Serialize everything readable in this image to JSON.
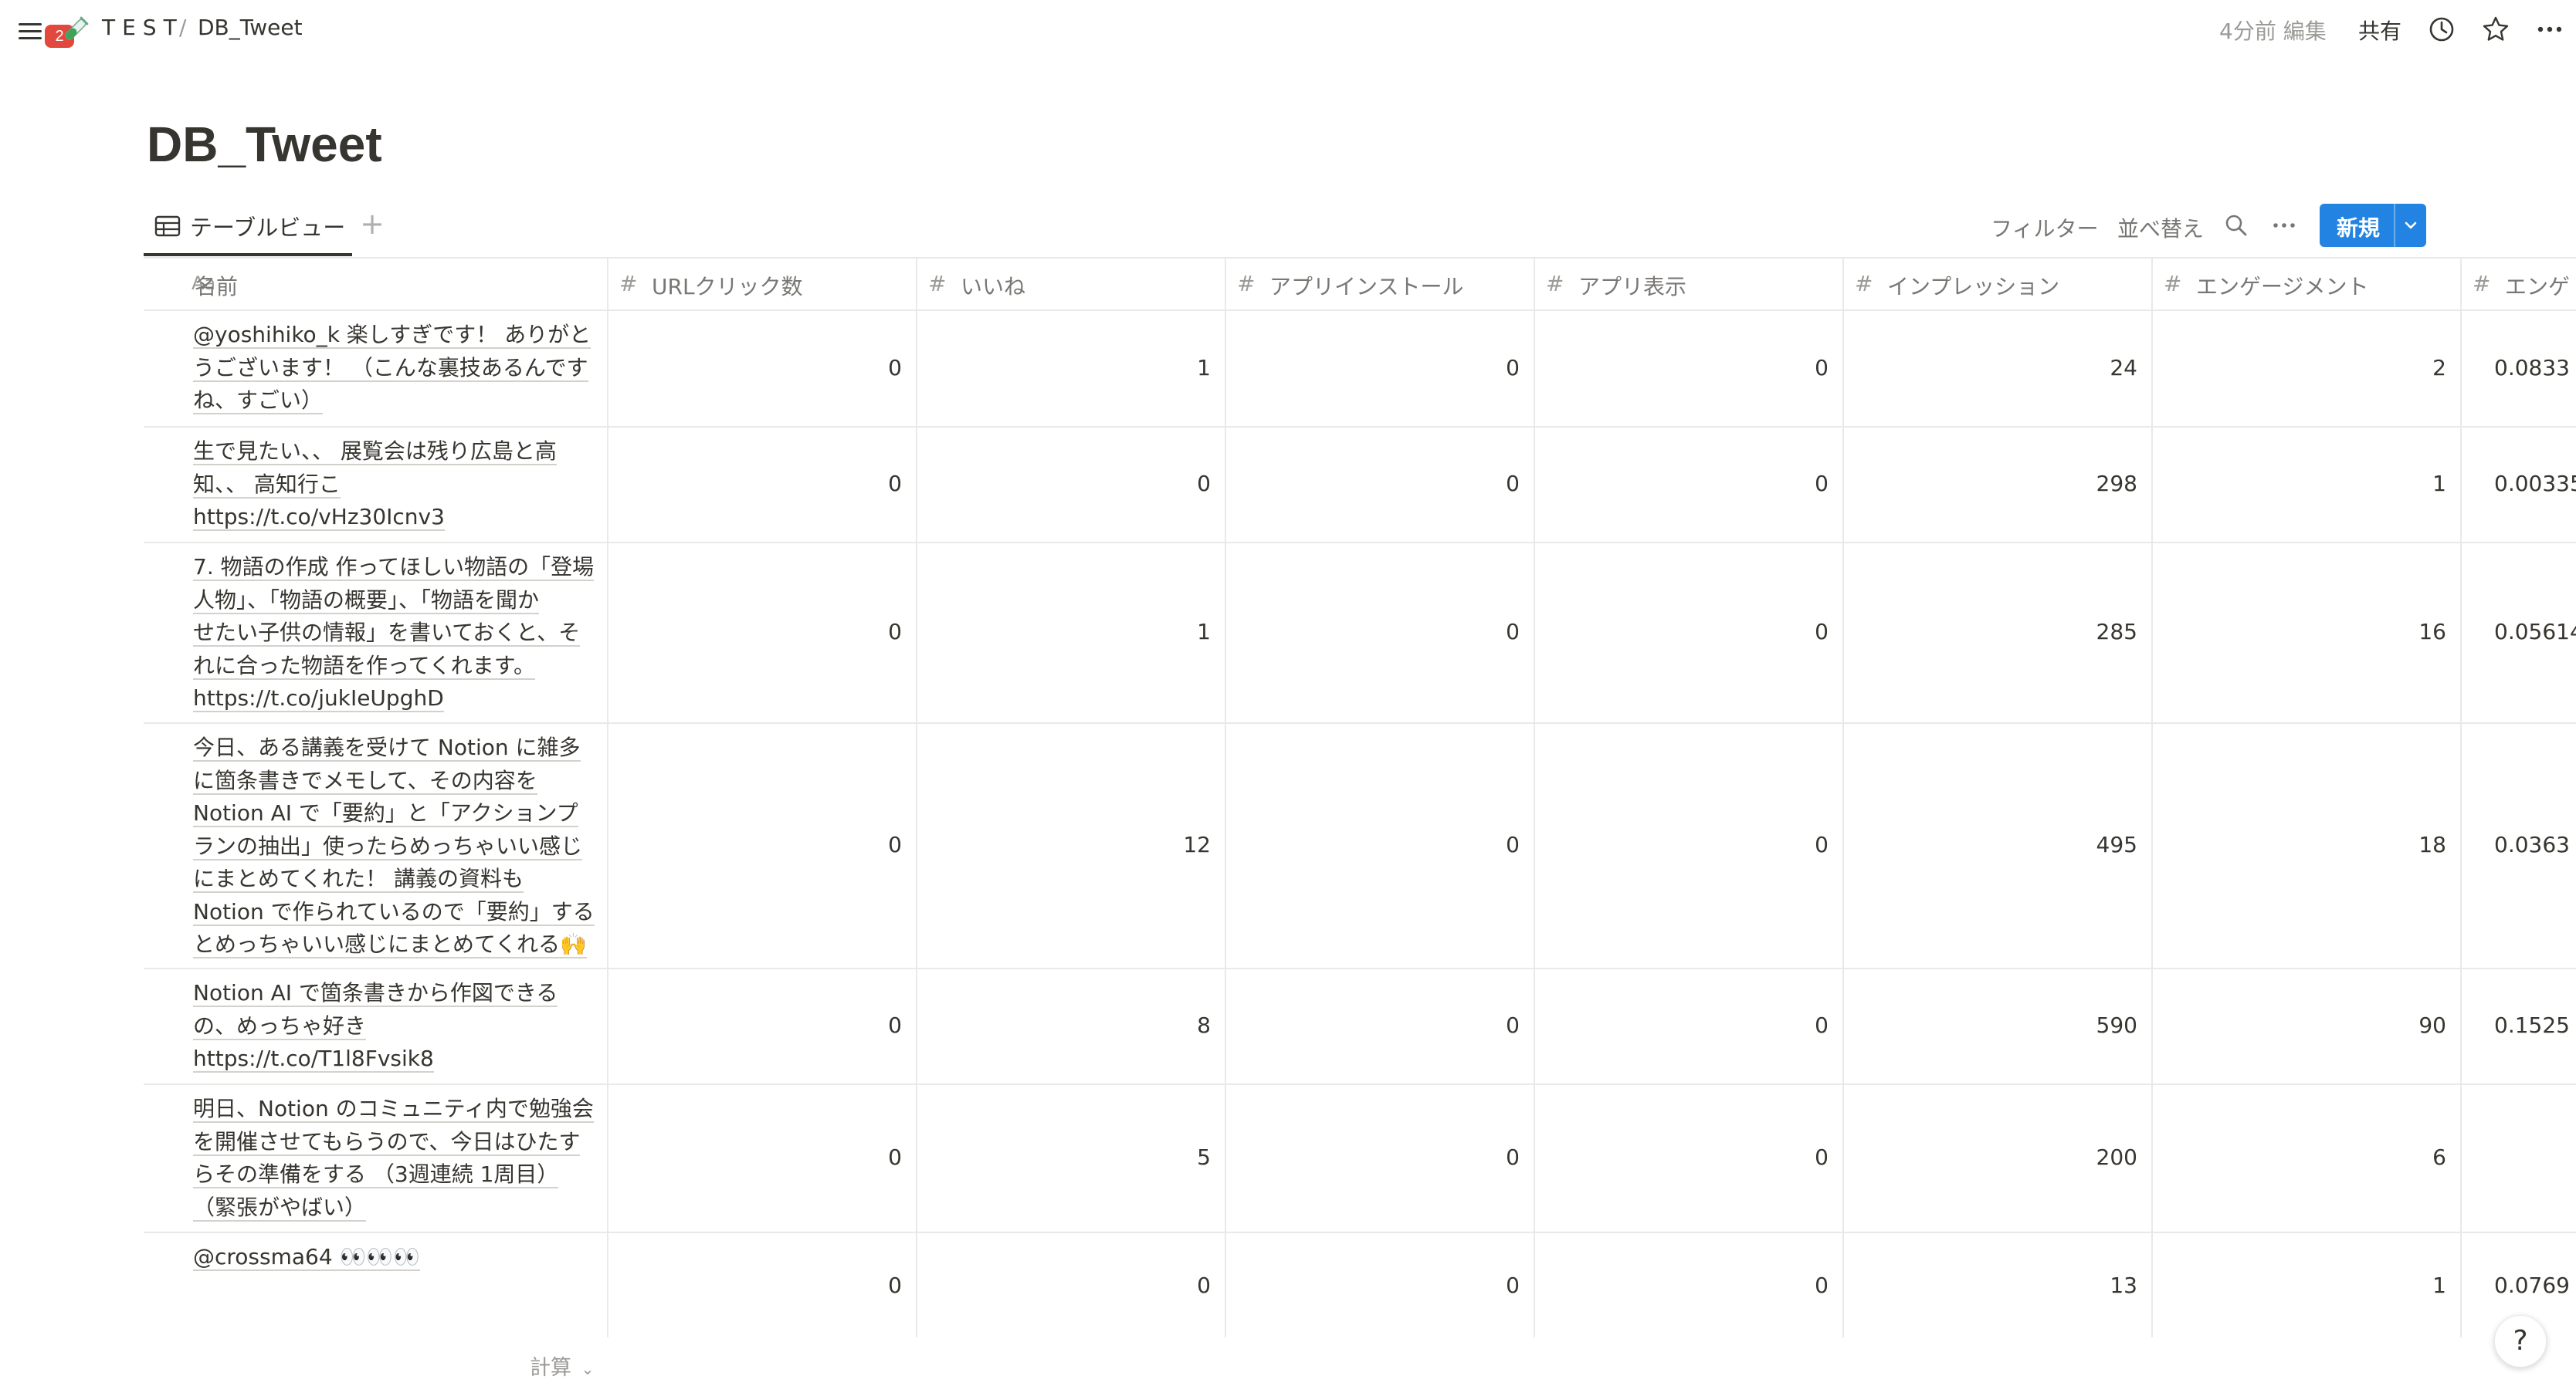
{
  "topbar": {
    "notification_count": "2",
    "workspace": "TEST",
    "separator": "/",
    "page": "DB_Tweet",
    "edited": "4分前 編集",
    "share": "共有",
    "page_icon": "test-tube-icon"
  },
  "title": "DB_Tweet",
  "view": {
    "tab_label": "テーブルビュー",
    "add": "+",
    "filter": "フィルター",
    "sort": "並べ替え",
    "new": "新規"
  },
  "columns": [
    {
      "icon": "Aa",
      "label": "名前"
    },
    {
      "icon": "#",
      "label": "URLクリック数"
    },
    {
      "icon": "#",
      "label": "いいね"
    },
    {
      "icon": "#",
      "label": "アプリインストール"
    },
    {
      "icon": "#",
      "label": "アプリ表示"
    },
    {
      "icon": "#",
      "label": "インプレッション"
    },
    {
      "icon": "#",
      "label": "エンゲージメント"
    },
    {
      "icon": "#",
      "label": "エンゲ"
    }
  ],
  "rows": [
    {
      "lines": [
        "@yoshihiko_k 楽しすぎです！ ありがと",
        "うございます！ （こんな裏技あるんです",
        "ね、すごい）"
      ],
      "url_clicks": "0",
      "likes": "1",
      "app_installs": "0",
      "app_views": "0",
      "impressions": "24",
      "engagements": "2",
      "rate": "0.0833"
    },
    {
      "lines": [
        "生で見たい、、 展覧会は残り広島と高",
        "知、、 高知行こ",
        "https://t.co/vHz30Icnv3"
      ],
      "url_clicks": "0",
      "likes": "0",
      "app_installs": "0",
      "app_views": "0",
      "impressions": "298",
      "engagements": "1",
      "rate": "0.00335"
    },
    {
      "lines": [
        "7. 物語の作成 作ってほしい物語の「登場",
        "人物」、「物語の概要」、「物語を聞か",
        "せたい子供の情報」を書いておくと、そ",
        "れに合った物語を作ってくれます。",
        "https://t.co/jukIeUpghD"
      ],
      "url_clicks": "0",
      "likes": "1",
      "app_installs": "0",
      "app_views": "0",
      "impressions": "285",
      "engagements": "16",
      "rate": "0.05614"
    },
    {
      "lines": [
        "今日、ある講義を受けて Notion に雑多",
        "に箇条書きでメモして、その内容を",
        "Notion AI で「要約」と「アクションプ",
        "ランの抽出」使ったらめっちゃいい感じ",
        "にまとめてくれた！ 講義の資料も",
        "Notion で作られているので「要約」する",
        "とめっちゃいい感じにまとめてくれる🙌"
      ],
      "url_clicks": "0",
      "likes": "12",
      "app_installs": "0",
      "app_views": "0",
      "impressions": "495",
      "engagements": "18",
      "rate": "0.0363"
    },
    {
      "lines": [
        "Notion AI で箇条書きから作図できる",
        "の、めっちゃ好き",
        "https://t.co/T1l8Fvsik8"
      ],
      "url_clicks": "0",
      "likes": "8",
      "app_installs": "0",
      "app_views": "0",
      "impressions": "590",
      "engagements": "90",
      "rate": "0.1525"
    },
    {
      "lines": [
        "明日、Notion のコミュニティ内で勉強会",
        "を開催させてもらうので、今日はひたす",
        "らその準備をする （3週連続 1周目）",
        "（緊張がやばい）"
      ],
      "url_clicks": "0",
      "likes": "5",
      "app_installs": "0",
      "app_views": "0",
      "impressions": "200",
      "engagements": "6",
      "rate": ""
    },
    {
      "lines": [
        "@crossma64 👀👀👀"
      ],
      "url_clicks": "0",
      "likes": "0",
      "app_installs": "0",
      "app_views": "0",
      "impressions": "13",
      "engagements": "1",
      "rate": "0.0769"
    }
  ],
  "footer": {
    "calc": "計算",
    "help": "?"
  },
  "colors": {
    "accent": "#2383e2",
    "badge": "#e2483d",
    "text": "#37352f",
    "muted": "#787774",
    "border": "#e9e9e7"
  }
}
